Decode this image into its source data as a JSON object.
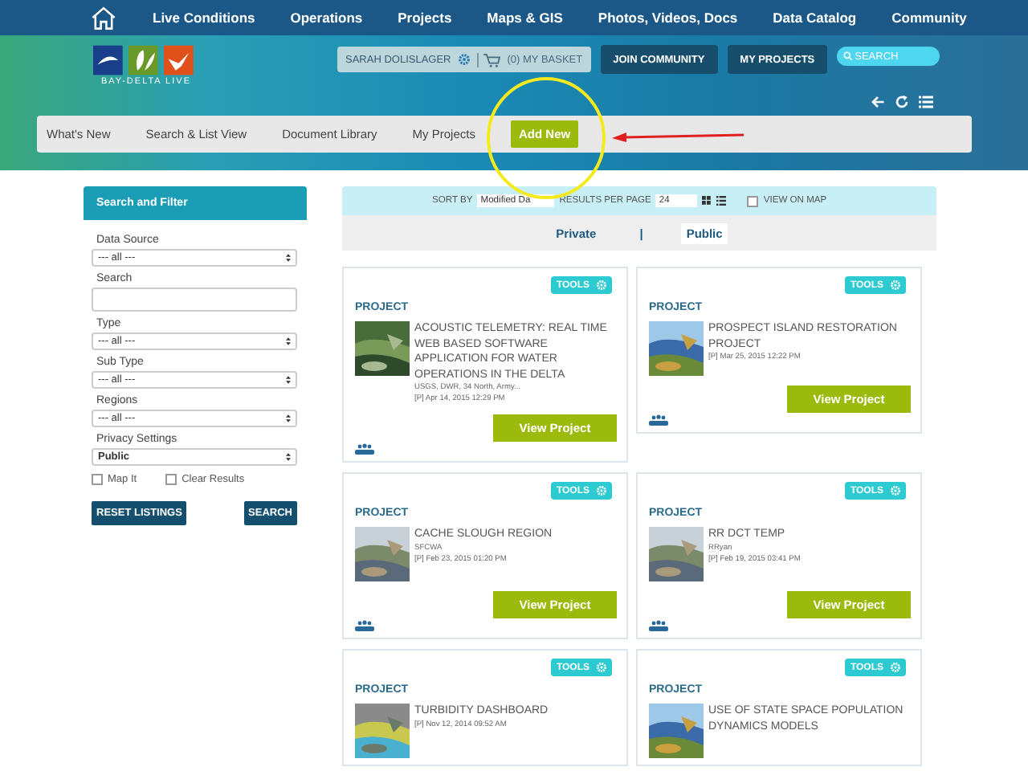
{
  "top_nav": {
    "items": [
      "Live Conditions",
      "Operations",
      "Projects",
      "Maps & GIS",
      "Photos, Videos, Docs",
      "Data Catalog",
      "Community"
    ]
  },
  "logo": {
    "text": "BAY-DELTA LIVE"
  },
  "user_bar": {
    "user": "SARAH DOLISLAGER",
    "basket": "(0) MY BASKET"
  },
  "header_buttons": [
    "JOIN COMMUNITY",
    "MY PROJECTS"
  ],
  "search": {
    "placeholder": "SEARCH"
  },
  "sub_nav": [
    {
      "label": "What's New",
      "selected": false
    },
    {
      "label": "Search & List View",
      "selected": false
    },
    {
      "label": "Document Library",
      "selected": false
    },
    {
      "label": "My Projects",
      "selected": false
    },
    {
      "label": "Add New",
      "selected": true
    }
  ],
  "filter": {
    "title": "Search and Filter",
    "fields": [
      {
        "kind": "select",
        "label": "Data Source",
        "value": "--- all ---"
      },
      {
        "kind": "text",
        "label": "Search"
      },
      {
        "kind": "select",
        "label": "Type",
        "value": "--- all ---"
      },
      {
        "kind": "select",
        "label": "Sub Type",
        "value": "--- all ---"
      },
      {
        "kind": "select",
        "label": "Regions",
        "value": "--- all ---"
      },
      {
        "kind": "select",
        "label": "Privacy Settings",
        "value": "Public"
      }
    ],
    "checkboxes": [
      {
        "label": "Map It",
        "checked": false
      },
      {
        "label": "Clear Results",
        "checked": false
      }
    ],
    "buttons": [
      "RESET LISTINGS",
      "SEARCH"
    ]
  },
  "sort_bar": {
    "sort_label": "SORT BY",
    "sort_value": "Modified Da",
    "per_page_label": "RESULTS PER PAGE",
    "per_page_value": "24",
    "view_on_map": {
      "label": "VIEW ON MAP",
      "checked": false
    }
  },
  "privacy_tabs": [
    {
      "label": "Private",
      "selected": false
    },
    {
      "label": "Public",
      "selected": true
    }
  ],
  "privacy_separator": "|",
  "cards": [
    {
      "type": "PROJECT",
      "tools": "TOOLS",
      "title": "ACOUSTIC TELEMETRY: REAL TIME WEB BASED SOFTWARE APPLICATION FOR WATER OPERATIONS IN THE DELTA",
      "authors": "USGS, DWR, 34 North, Army...",
      "date": "[P] Apr 14, 2015 12:29 PM",
      "button": "View Project"
    },
    {
      "type": "PROJECT",
      "tools": "TOOLS",
      "title": "PROSPECT ISLAND RESTORATION PROJECT",
      "date": "[P] Mar 25, 2015 12:22 PM",
      "button": "View Project"
    },
    {
      "type": "PROJECT",
      "tools": "TOOLS",
      "title": "CACHE SLOUGH REGION",
      "authors": "SFCWA",
      "date": "[P] Feb 23, 2015 01:20 PM",
      "button": "View Project"
    },
    {
      "type": "PROJECT",
      "tools": "TOOLS",
      "title": "RR DCT TEMP",
      "authors": "RRyan",
      "date": "[P] Feb 19, 2015 03:41 PM",
      "button": "View Project"
    },
    {
      "type": "PROJECT",
      "tools": "TOOLS",
      "title": "TURBIDITY DASHBOARD",
      "date": "[P] Nov 12, 2014 09:52 AM"
    },
    {
      "type": "PROJECT",
      "tools": "TOOLS",
      "title": "USE OF STATE SPACE POPULATION DYNAMICS MODELS"
    }
  ]
}
